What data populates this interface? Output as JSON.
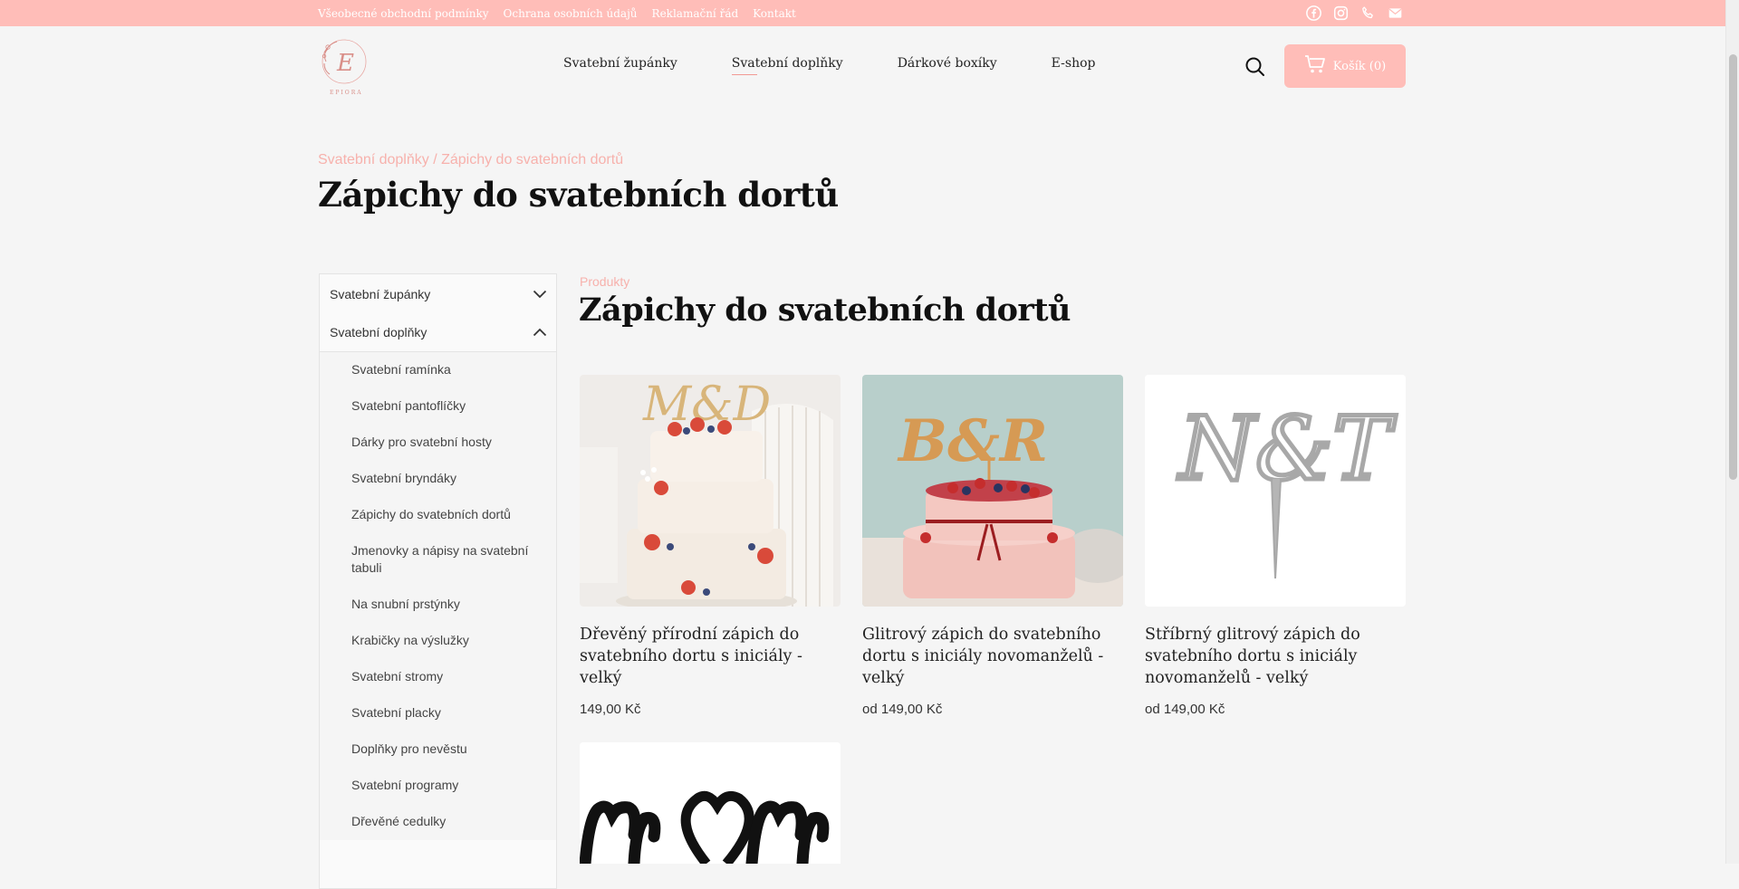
{
  "topbar": {
    "links": [
      "Všeobecné obchodní podmínky",
      "Ochrana osobních údajů",
      "Reklamační řád",
      "Kontakt"
    ],
    "icons": [
      "facebook-icon",
      "instagram-icon",
      "phone-icon",
      "mail-icon"
    ]
  },
  "header": {
    "logo_text": "EPIORA",
    "nav": [
      "Svatební župánky",
      "Svatební doplňky",
      "Dárkové boxíky",
      "E-shop"
    ],
    "active_nav": "Svatební doplňky",
    "cart_label": "Košík (0)"
  },
  "page": {
    "breadcrumb": "Svatební doplňky / Zápichy do svatebních dortů",
    "title": "Zápichy do svatebních dortů"
  },
  "sidebar": {
    "top_items": [
      "Svatební župánky",
      "Svatební doplňky"
    ],
    "sub_items": [
      "Svatební ramínka",
      "Svatební pantoflíčky",
      "Dárky pro svatební hosty",
      "Svatební bryndáky",
      "Zápichy do svatebních dortů",
      "Jmenovky a nápisy na svatební tabuli",
      "Na snubní prstýnky",
      "Krabičky na výslužky",
      "Svatební stromy",
      "Svatební placky",
      "Doplňky pro nevěstu",
      "Svatební programy",
      "Dřevěné cedulky"
    ]
  },
  "main": {
    "section_label": "Produkty",
    "section_title": "Zápichy do svatebních dortů",
    "products": [
      {
        "name": "Dřevěný přírodní zápich do svatebního dortu s iniciály - velký",
        "price": "149,00 Kč",
        "image_text": "M&D"
      },
      {
        "name": "Glitrový zápich do svatebního dortu s iniciály novomanželů - velký",
        "price": "od 149,00 Kč",
        "image_text": "B&R"
      },
      {
        "name": "Stříbrný glitrový zápich do svatebního dortu s iniciály novomanželů - velký",
        "price": "od 149,00 Kč",
        "image_text": "N&T"
      }
    ]
  },
  "colors": {
    "accent": "#ffbdb8",
    "accent_text": "#f7b1ac",
    "background": "#f5f5f5"
  }
}
